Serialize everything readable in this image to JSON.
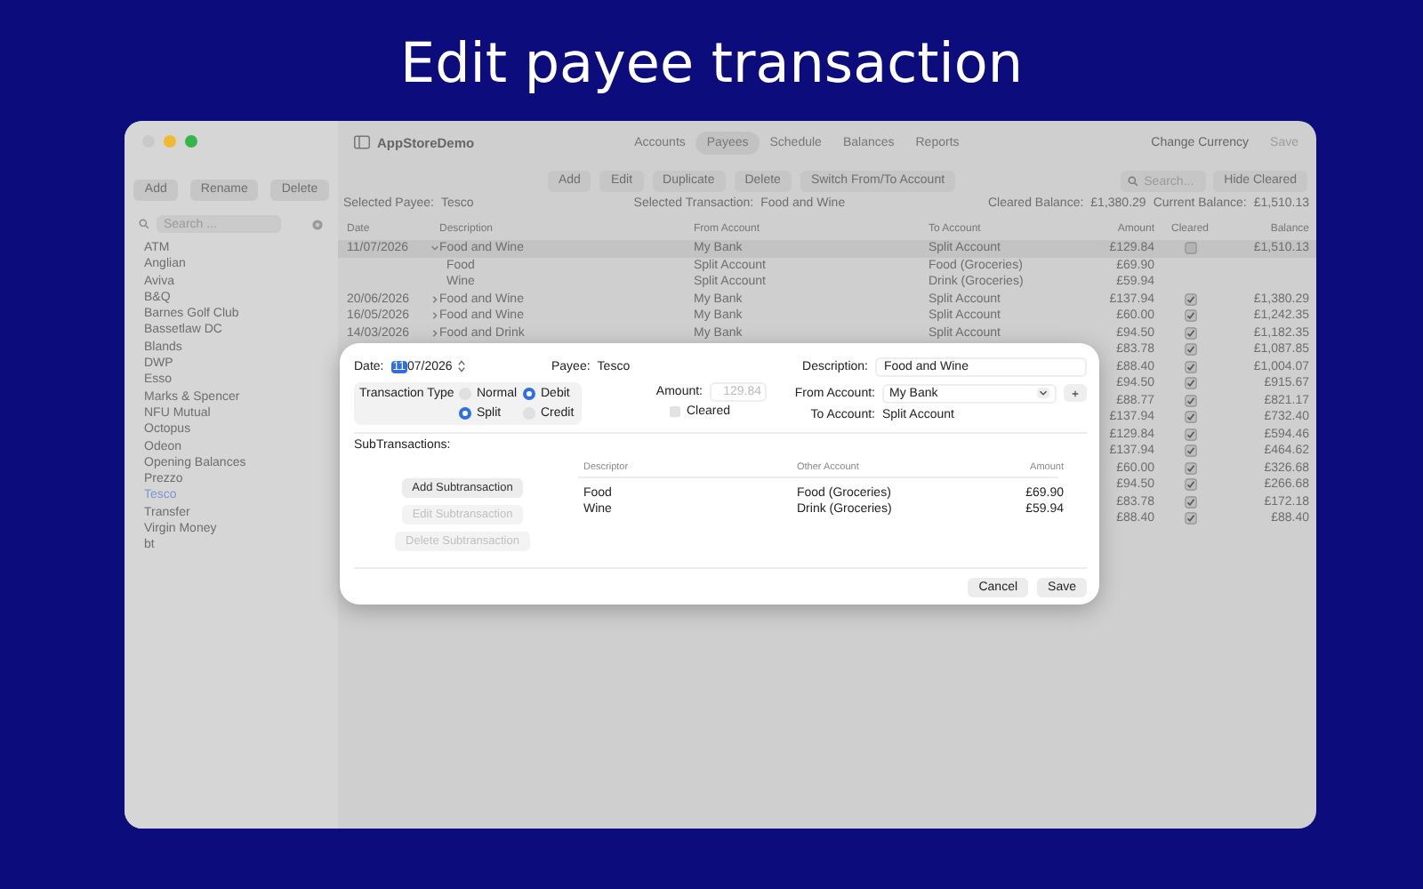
{
  "headline": "Edit payee transaction",
  "window": {
    "app_title": "AppStoreDemo",
    "nav_tabs": [
      {
        "label": "Accounts",
        "selected": false
      },
      {
        "label": "Payees",
        "selected": true
      },
      {
        "label": "Schedule",
        "selected": false
      },
      {
        "label": "Balances",
        "selected": false
      },
      {
        "label": "Reports",
        "selected": false
      }
    ],
    "title_actions": [
      {
        "label": "Change Currency",
        "disabled": false
      },
      {
        "label": "Save",
        "disabled": true
      }
    ]
  },
  "sidebar": {
    "buttons": [
      "Add",
      "Rename",
      "Delete"
    ],
    "search": {
      "placeholder": "Search ..."
    },
    "items": [
      {
        "label": "ATM",
        "selected": false
      },
      {
        "label": "Anglian",
        "selected": false
      },
      {
        "label": "Aviva",
        "selected": false
      },
      {
        "label": "B&Q",
        "selected": false
      },
      {
        "label": "Barnes Golf Club",
        "selected": false
      },
      {
        "label": "Bassetlaw DC",
        "selected": false
      },
      {
        "label": "Blands",
        "selected": false
      },
      {
        "label": "DWP",
        "selected": false
      },
      {
        "label": "Esso",
        "selected": false
      },
      {
        "label": "Marks & Spencer",
        "selected": false
      },
      {
        "label": "NFU Mutual",
        "selected": false
      },
      {
        "label": "Octopus",
        "selected": false
      },
      {
        "label": "Odeon",
        "selected": false
      },
      {
        "label": "Opening Balances",
        "selected": false
      },
      {
        "label": "Prezzo",
        "selected": false
      },
      {
        "label": "Tesco",
        "selected": true
      },
      {
        "label": "Transfer",
        "selected": false
      },
      {
        "label": "Virgin Money",
        "selected": false
      },
      {
        "label": "bt",
        "selected": false
      }
    ]
  },
  "toolbar": {
    "buttons": [
      "Add",
      "Edit",
      "Duplicate",
      "Delete",
      "Switch From/To Account"
    ],
    "search": {
      "placeholder": "Search..."
    },
    "hide_button": "Hide Cleared"
  },
  "info": {
    "payee_label": "Selected Payee:",
    "payee": "Tesco",
    "transaction_label": "Selected Transaction:",
    "transaction": "Food and Wine",
    "cleared_label": "Cleared Balance:",
    "cleared": "£1,380.29",
    "current_label": "Current Balance:",
    "current": "£1,510.13"
  },
  "table": {
    "columns": [
      "Date",
      "Description",
      "From Account",
      "To Account",
      "Amount",
      "Cleared",
      "Balance"
    ],
    "rows": [
      {
        "date": "11/07/2026",
        "description": "Food and Wine",
        "expanded": true,
        "from": "My Bank",
        "to": "Split Account",
        "amount": "£129.84",
        "cleared": false,
        "balance": "£1,510.13",
        "selected": true,
        "children": [
          {
            "description": "Food",
            "from": "Split Account",
            "to": "Food (Groceries)",
            "amount": "£69.90"
          },
          {
            "description": "Wine",
            "from": "Split Account",
            "to": "Drink (Groceries)",
            "amount": "£59.94"
          }
        ]
      },
      {
        "date": "20/06/2026",
        "description": "Food and Wine",
        "expanded": false,
        "from": "My Bank",
        "to": "Split Account",
        "amount": "£137.94",
        "cleared": true,
        "balance": "£1,380.29",
        "selected": false
      },
      {
        "date": "16/05/2026",
        "description": "Food and Wine",
        "expanded": false,
        "from": "My Bank",
        "to": "Split Account",
        "amount": "£60.00",
        "cleared": true,
        "balance": "£1,242.35",
        "selected": false
      },
      {
        "date": "14/03/2026",
        "description": "Food and Drink",
        "expanded": false,
        "from": "My Bank",
        "to": "Split Account",
        "amount": "£94.50",
        "cleared": true,
        "balance": "£1,182.35",
        "selected": false
      },
      {
        "amount": "£83.78",
        "cleared": true,
        "balance": "£1,087.85",
        "selected": false
      },
      {
        "amount": "£88.40",
        "cleared": true,
        "balance": "£1,004.07",
        "selected": false
      },
      {
        "amount": "£94.50",
        "cleared": true,
        "balance": "£915.67",
        "selected": false
      },
      {
        "amount": "£88.77",
        "cleared": true,
        "balance": "£821.17",
        "selected": false
      },
      {
        "amount": "£137.94",
        "cleared": true,
        "balance": "£732.40",
        "selected": false
      },
      {
        "amount": "£129.84",
        "cleared": true,
        "balance": "£594.46",
        "selected": false
      },
      {
        "amount": "£137.94",
        "cleared": true,
        "balance": "£464.62",
        "selected": false
      },
      {
        "amount": "£60.00",
        "cleared": true,
        "balance": "£326.68",
        "selected": false
      },
      {
        "amount": "£94.50",
        "cleared": true,
        "balance": "£266.68",
        "selected": false
      },
      {
        "amount": "£83.78",
        "cleared": true,
        "balance": "£172.18",
        "selected": false
      },
      {
        "amount": "£88.40",
        "cleared": true,
        "balance": "£88.40",
        "selected": false
      }
    ]
  },
  "dialog": {
    "date_label": "Date:",
    "date_segments": [
      {
        "text": "11",
        "selected": true
      },
      {
        "text": "07/2026",
        "selected": false
      }
    ],
    "payee_label": "Payee:",
    "payee": "Tesco",
    "description_label": "Description:",
    "description": "Food and Wine",
    "type_label": "Transaction Type",
    "type_options": [
      {
        "label": "Normal",
        "selected": false
      },
      {
        "label": "Debit",
        "selected": true
      },
      {
        "label": "Split",
        "selected": true
      },
      {
        "label": "Credit",
        "selected": false
      }
    ],
    "amount_label": "Amount:",
    "amount": {
      "value": "129.84",
      "disabled": true
    },
    "cleared": {
      "label": "Cleared",
      "checked": false
    },
    "from_label": "From Account:",
    "from": "My Bank",
    "to_label": "To Account:",
    "to": "Split Account",
    "sub_label": "SubTransactions:",
    "sub_buttons": [
      {
        "label": "Add Subtransaction",
        "disabled": false
      },
      {
        "label": "Edit Subtransaction",
        "disabled": true
      },
      {
        "label": "Delete Subtransaction",
        "disabled": true
      }
    ],
    "sub_columns": [
      "Descriptor",
      "Other Account",
      "Amount"
    ],
    "sub_rows": [
      {
        "descriptor": "Food",
        "account": "Food (Groceries)",
        "amount": "£69.90"
      },
      {
        "descriptor": "Wine",
        "account": "Drink (Groceries)",
        "amount": "£59.94"
      }
    ],
    "buttons": [
      "Cancel",
      "Save"
    ]
  }
}
